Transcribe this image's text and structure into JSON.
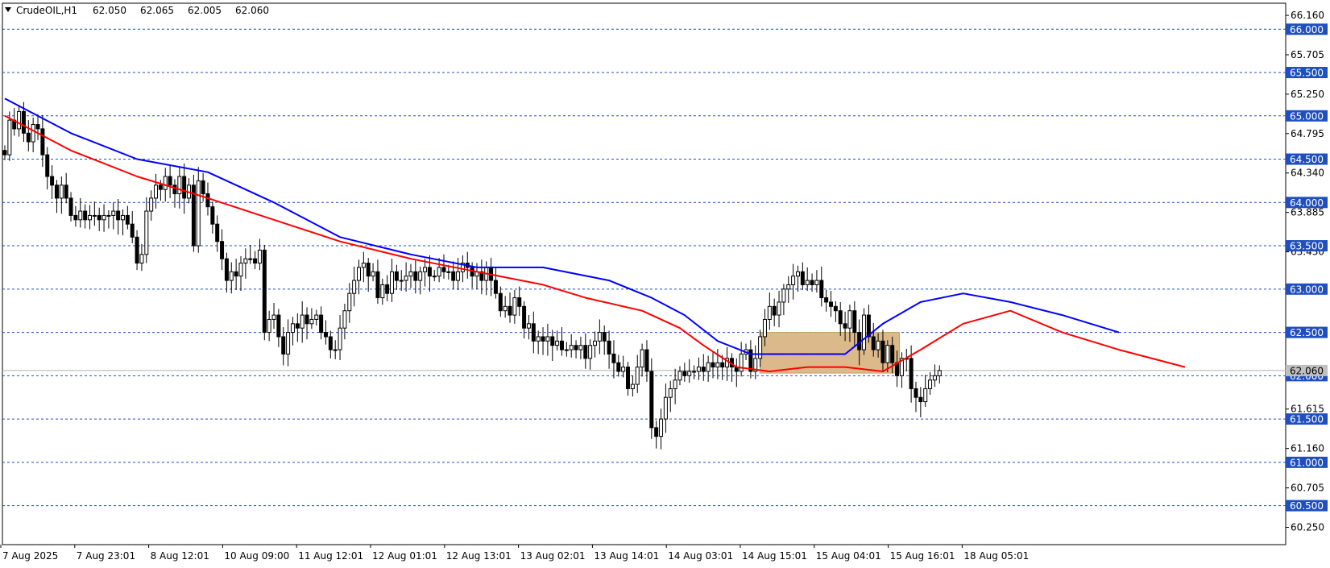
{
  "chart_data": {
    "type": "candlestick",
    "title": "CrudeOIL,H1",
    "ohlc_current": [
      "62.050",
      "62.065",
      "62.005",
      "62.060"
    ],
    "ylim": [
      60.05,
      66.3
    ],
    "y_ticks": [
      "66.160",
      "65.705",
      "65.250",
      "64.795",
      "64.340",
      "63.885",
      "63.430",
      "62.975",
      "62.520",
      "62.060",
      "61.615",
      "61.160",
      "60.705",
      "60.250"
    ],
    "level_labels": [
      "66.000",
      "65.500",
      "65.000",
      "64.500",
      "64.000",
      "63.500",
      "63.000",
      "62.500",
      "62.000",
      "61.500",
      "61.000",
      "60.500"
    ],
    "current_price_label": "62.060",
    "current_price": 62.06,
    "x_labels": [
      "7 Aug 2025",
      "7 Aug 23:01",
      "8 Aug 12:01",
      "10 Aug 09:00",
      "11 Aug 12:01",
      "12 Aug 01:01",
      "12 Aug 13:01",
      "13 Aug 02:01",
      "13 Aug 14:01",
      "14 Aug 03:01",
      "14 Aug 15:01",
      "15 Aug 04:01",
      "15 Aug 16:01",
      "18 Aug 05:01"
    ],
    "zone": {
      "from_bar": 160,
      "to_bar": 189,
      "low": 62.03,
      "high": 62.5,
      "color": "#dcb98a"
    },
    "colors": {
      "ema_fast": "#ff0000",
      "ema_slow": "#0000ff",
      "bull_body": "#ffffff",
      "bear_body": "#000000",
      "level_line": "#1f4fbf",
      "label_box": "#1f4fbf"
    },
    "closes": [
      64.55,
      64.95,
      64.85,
      65.05,
      64.8,
      64.7,
      64.9,
      64.85,
      64.55,
      64.3,
      64.2,
      64.05,
      64.2,
      64.05,
      63.85,
      63.8,
      63.9,
      63.8,
      63.85,
      63.85,
      63.8,
      63.85,
      63.85,
      63.9,
      63.8,
      63.85,
      63.75,
      63.6,
      63.3,
      63.4,
      63.9,
      64.05,
      64.2,
      64.15,
      64.3,
      64.2,
      64.1,
      64.3,
      64.05,
      64.2,
      63.5,
      64.25,
      64.1,
      63.95,
      63.75,
      63.55,
      63.35,
      63.1,
      63.2,
      63.15,
      63.3,
      63.35,
      63.35,
      63.3,
      63.45,
      62.5,
      62.65,
      62.7,
      62.45,
      62.25,
      62.5,
      62.6,
      62.55,
      62.7,
      62.6,
      62.65,
      62.7,
      62.5,
      62.45,
      62.3,
      62.3,
      62.55,
      62.75,
      62.95,
      63.1,
      63.25,
      63.3,
      63.15,
      63.2,
      62.9,
      63.05,
      62.95,
      63.2,
      63.1,
      63.1,
      63.15,
      63.2,
      63.1,
      63.2,
      63.25,
      63.15,
      63.15,
      63.25,
      63.2,
      63.2,
      63.1,
      63.2,
      63.3,
      63.25,
      63.15,
      63.2,
      63.1,
      63.25,
      63.1,
      62.95,
      62.75,
      62.8,
      62.7,
      62.9,
      62.8,
      62.55,
      62.6,
      62.4,
      62.45,
      62.4,
      62.45,
      62.35,
      62.4,
      62.3,
      62.3,
      62.35,
      62.3,
      62.35,
      62.2,
      62.35,
      62.4,
      62.5,
      62.4,
      62.25,
      62.15,
      62.05,
      62.1,
      61.85,
      61.9,
      62.1,
      62.3,
      62.05,
      61.4,
      61.3,
      61.5,
      61.75,
      61.85,
      61.95,
      62.05,
      62.0,
      62.05,
      62.05,
      62.1,
      62.05,
      62.15,
      62.1,
      62.15,
      62.1,
      62.2,
      62.1,
      62.05,
      62.25,
      62.3,
      62.05,
      62.2,
      62.45,
      62.65,
      62.8,
      62.7,
      62.85,
      63.0,
      63.05,
      63.15,
      63.2,
      63.05,
      63.1,
      63.05,
      63.1,
      62.9,
      62.85,
      62.8,
      62.75,
      62.6,
      62.55,
      62.75,
      62.5,
      62.3,
      62.7,
      62.45,
      62.3,
      62.4,
      62.15,
      62.35,
      62.15,
      62.0,
      62.2,
      62.2,
      61.85,
      61.75,
      61.7,
      61.85,
      61.95,
      62.0,
      62.06
    ],
    "ema_fast_values": [
      65.0,
      64.6,
      64.3,
      64.05,
      63.8,
      63.55,
      63.35,
      63.2,
      63.05,
      62.9,
      62.75,
      62.55,
      62.35,
      62.1,
      62.05,
      62.1,
      62.1,
      62.05,
      62.3,
      62.6,
      62.75,
      62.5,
      62.3,
      62.1
    ],
    "ema_slow_values": [
      65.2,
      64.8,
      64.5,
      64.35,
      64.0,
      63.6,
      63.4,
      63.25,
      63.25,
      63.1,
      62.9,
      62.7,
      62.4,
      62.25,
      62.25,
      62.25,
      62.6,
      62.85,
      62.95,
      62.85,
      62.7,
      62.5
    ],
    "ema_fast_bars": [
      0,
      14,
      28,
      43,
      57,
      71,
      86,
      100,
      114,
      123,
      135,
      143,
      148,
      155,
      162,
      170,
      178,
      186,
      194,
      203,
      213,
      224,
      236,
      250
    ],
    "ema_slow_bars": [
      0,
      14,
      28,
      43,
      57,
      71,
      86,
      100,
      114,
      128,
      137,
      144,
      151,
      158,
      170,
      178,
      186,
      194,
      203,
      213,
      224,
      236
    ]
  }
}
